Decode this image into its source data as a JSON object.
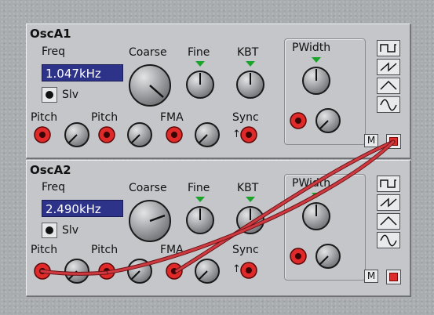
{
  "osc1": {
    "title": "OscA1",
    "freq_label": "Freq",
    "freq_value": "1.047kHz",
    "slv_label": "Slv",
    "coarse_label": "Coarse",
    "fine_label": "Fine",
    "kbt_label": "KBT",
    "pwidth_label": "PWidth",
    "pitch1_label": "Pitch",
    "pitch2_label": "Pitch",
    "fma_label": "FMA",
    "sync_label": "Sync",
    "m_label": "M"
  },
  "osc2": {
    "title": "OscA2",
    "freq_label": "Freq",
    "freq_value": "2.490kHz",
    "slv_label": "Slv",
    "coarse_label": "Coarse",
    "fine_label": "Fine",
    "kbt_label": "KBT",
    "pwidth_label": "PWidth",
    "pitch1_label": "Pitch",
    "pitch2_label": "Pitch",
    "fma_label": "FMA",
    "sync_label": "Sync",
    "m_label": "M"
  },
  "waveforms": [
    "square-wave-icon",
    "saw-wave-icon",
    "triangle-wave-icon",
    "sine-wave-icon"
  ],
  "colors": {
    "panel": "#c4c6ca",
    "display_bg": "#2d3388",
    "jack_red": "#e02a2a",
    "cable": "#c8323a",
    "tick_green": "#1aa52a"
  }
}
